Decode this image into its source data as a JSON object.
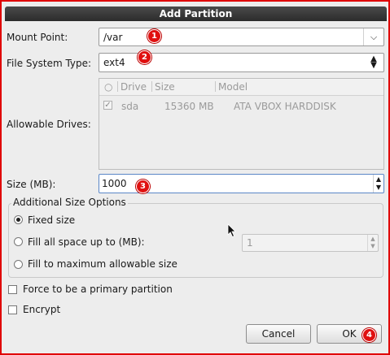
{
  "window": {
    "title": "Add Partition"
  },
  "mount_point": {
    "label": "Mount Point:",
    "value": "/var"
  },
  "fs_type": {
    "label": "File System Type:",
    "value": "ext4"
  },
  "drives": {
    "label": "Allowable Drives:",
    "columns": [
      "Drive",
      "Size",
      "Model"
    ],
    "rows": [
      {
        "drive": "sda",
        "size": "15360 MB",
        "model": "ATA VBOX HARDDISK"
      }
    ]
  },
  "size": {
    "label": "Size (MB):",
    "value": "1000"
  },
  "options": {
    "legend": "Additional Size Options",
    "fixed": "Fixed size",
    "fill_up_to": "Fill all space up to (MB):",
    "fill_up_to_value": "1",
    "fill_max": "Fill to maximum allowable size"
  },
  "primary": "Force to be a primary partition",
  "encrypt": "Encrypt",
  "buttons": {
    "cancel": "Cancel",
    "ok": "OK"
  },
  "badges": [
    "1",
    "2",
    "3",
    "4"
  ],
  "accent": "#e01010"
}
